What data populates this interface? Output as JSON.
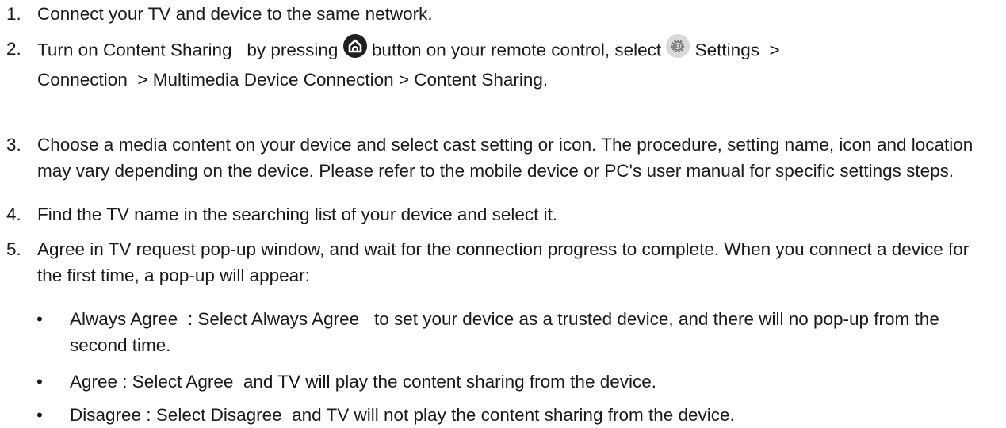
{
  "steps": [
    {
      "number": "1.",
      "text": "Connect your TV and device to the same network."
    },
    {
      "number": "2.",
      "part1": "Turn on Content Sharing   by pressing",
      "home_icon": "home-icon",
      "part2": "button on your remote control, select",
      "settings_icon": "gear-icon",
      "part3": "Settings  >",
      "part4": "Connection  > Multimedia Device Connection > Content Sharing."
    },
    {
      "number": "3.",
      "text": "Choose a media content on your device and select cast setting or icon. The procedure, setting name, icon and location may vary depending on the device. Please refer to the mobile device or PC's user manual for specific settings steps."
    },
    {
      "number": "4.",
      "text": "Find the TV name in the searching list of your device and select it."
    },
    {
      "number": "5.",
      "text": "Agree in TV request pop-up window, and wait for the connection progress to complete. When you connect a device for the first time, a pop-up will appear:"
    }
  ],
  "bullets": [
    {
      "marker": "•",
      "text": "Always Agree  : Select Always Agree   to set your device as a trusted device, and there will no pop-up from the second time."
    },
    {
      "marker": "•",
      "text": "Agree : Select Agree  and TV will play the content sharing from the device."
    },
    {
      "marker": "•",
      "text": "Disagree : Select Disagree  and TV will not play the content sharing from the device."
    }
  ]
}
